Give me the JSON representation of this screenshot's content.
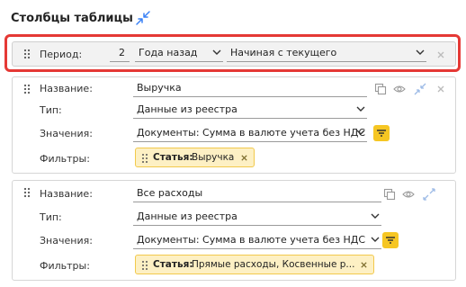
{
  "header": {
    "title": "Столбцы таблицы"
  },
  "period": {
    "label": "Период:",
    "count": "2",
    "unit": "Года назад",
    "start": "Начиная с текущего"
  },
  "columns": [
    {
      "name_label": "Название:",
      "name_value": "Выручка",
      "type_label": "Тип:",
      "type_value": "Данные из реестра",
      "values_label": "Значения:",
      "values_value": "Документы: Сумма в валюте учета без НДС",
      "filters_label": "Фильтры:",
      "filter_chip": {
        "key": "Статья:",
        "value": "Выручка"
      }
    },
    {
      "name_label": "Название:",
      "name_value": "Все расходы",
      "type_label": "Тип:",
      "type_value": "Данные из реестра",
      "values_label": "Значения:",
      "values_value": "Документы: Сумма в валюте учета без НДС",
      "filters_label": "Фильтры:",
      "filter_chip": {
        "key": "Статья:",
        "value": "Прямые расходы, Косвенные р..."
      }
    }
  ],
  "colors": {
    "accent": "#3b82f6",
    "highlight": "#e53935",
    "filter": "#f6c623",
    "chip_bg": "#fdf0c4"
  }
}
